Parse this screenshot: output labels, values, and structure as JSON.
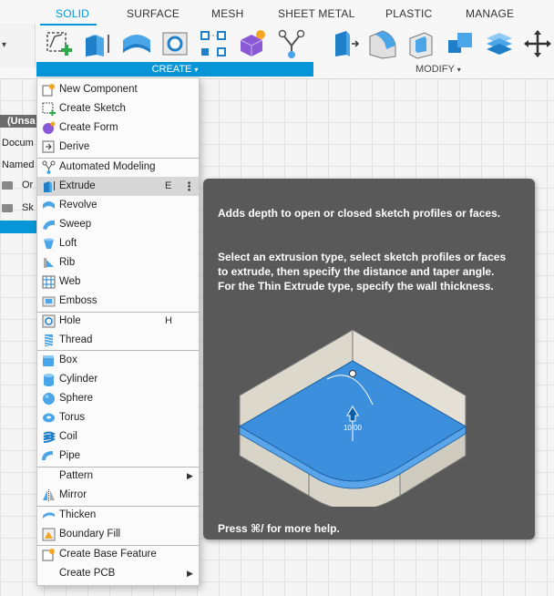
{
  "tabs": [
    "SOLID",
    "SURFACE",
    "MESH",
    "SHEET METAL",
    "PLASTIC",
    "MANAGE"
  ],
  "active_tab": "SOLID",
  "ribbon": {
    "create_label": "CREATE",
    "modify_label": "MODIFY"
  },
  "browser": {
    "unsaved": "(Unsa",
    "document": "Docum",
    "named": "Named",
    "origin": "Or",
    "sketches": "Sk"
  },
  "menu": {
    "items": [
      {
        "label": "New Component",
        "icon": "new-component-icon"
      },
      {
        "label": "Create Sketch",
        "icon": "create-sketch-icon"
      },
      {
        "label": "Create Form",
        "icon": "create-form-icon"
      },
      {
        "label": "Derive",
        "icon": "derive-icon"
      },
      {
        "label": "Automated Modeling",
        "icon": "automated-modeling-icon"
      },
      {
        "label": "Extrude",
        "icon": "extrude-icon",
        "shortcut": "E"
      },
      {
        "label": "Revolve",
        "icon": "revolve-icon"
      },
      {
        "label": "Sweep",
        "icon": "sweep-icon"
      },
      {
        "label": "Loft",
        "icon": "loft-icon"
      },
      {
        "label": "Rib",
        "icon": "rib-icon"
      },
      {
        "label": "Web",
        "icon": "web-icon"
      },
      {
        "label": "Emboss",
        "icon": "emboss-icon"
      },
      {
        "label": "Hole",
        "icon": "hole-icon",
        "shortcut": "H"
      },
      {
        "label": "Thread",
        "icon": "thread-icon"
      },
      {
        "label": "Box",
        "icon": "box-icon"
      },
      {
        "label": "Cylinder",
        "icon": "cylinder-icon"
      },
      {
        "label": "Sphere",
        "icon": "sphere-icon"
      },
      {
        "label": "Torus",
        "icon": "torus-icon"
      },
      {
        "label": "Coil",
        "icon": "coil-icon"
      },
      {
        "label": "Pipe",
        "icon": "pipe-icon"
      },
      {
        "label": "Pattern",
        "icon": ""
      },
      {
        "label": "Mirror",
        "icon": "mirror-icon"
      },
      {
        "label": "Thicken",
        "icon": "thicken-icon"
      },
      {
        "label": "Boundary Fill",
        "icon": "boundary-fill-icon"
      },
      {
        "label": "Create Base Feature",
        "icon": "create-base-feature-icon"
      },
      {
        "label": "Create PCB",
        "icon": ""
      }
    ]
  },
  "tooltip": {
    "summary": "Adds depth to open or closed sketch profiles or faces.",
    "detail": "Select an extrusion type, select sketch profiles or faces to extrude, then specify the distance and taper angle. For the Thin Extrude type, specify the wall thickness.",
    "dimension": "10.00",
    "help": "Press ⌘/ for more help."
  },
  "colors": {
    "accent": "#0696d7",
    "tooltip_bg": "#595959",
    "highlight": "#d7d7d7"
  }
}
